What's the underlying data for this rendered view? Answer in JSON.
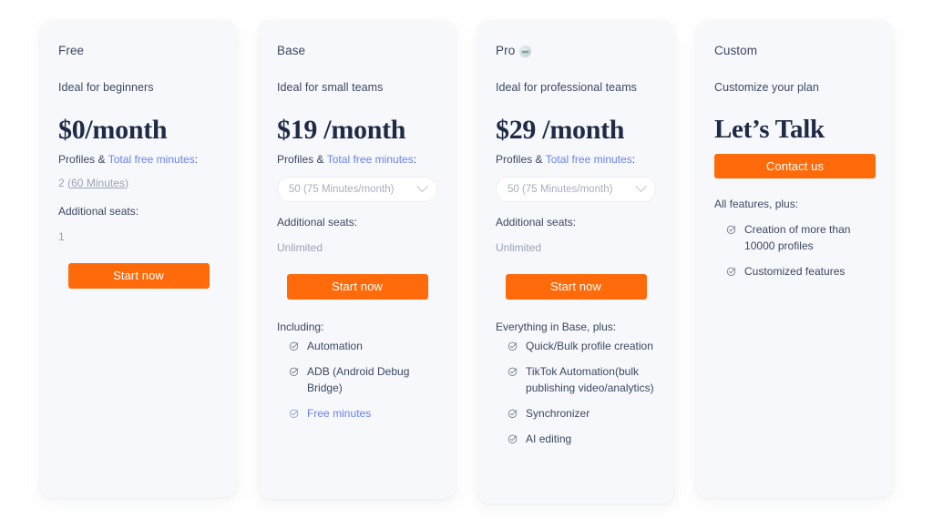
{
  "theme": {
    "accent": "#ff6b0a",
    "card_bg": "#f6f8fb",
    "page_bg": "#ffffff",
    "text": "#3d4761",
    "muted": "#9aa3b4",
    "link": "#6b82ea"
  },
  "plans": [
    {
      "name": "Free",
      "badge_icon": "",
      "tagline": "Ideal for beginners",
      "price": "$0/month",
      "profiles_label_prefix": "Profiles & ",
      "profiles_label_link": "Total free minutes",
      "profiles_label_suffix": ":",
      "profiles_value_plain": "2 ",
      "profiles_value_underlined": "(60 Minutes)",
      "seats_label": "Additional seats:",
      "seats_value": "1",
      "cta_label": "Start now",
      "features_heading": "",
      "features": []
    },
    {
      "name": "Base",
      "badge_icon": "",
      "tagline": "Ideal for small teams",
      "price": "$19 /month",
      "profiles_label_prefix": "Profiles & ",
      "profiles_label_link": "Total free minutes",
      "profiles_label_suffix": ":",
      "select_value": "50 (75 Minutes/month)",
      "select_icon": "chevron-down-icon",
      "seats_label": "Additional seats:",
      "seats_value": "Unlimited",
      "cta_label": "Start now",
      "features_heading": "Including:",
      "features": [
        {
          "text": "Automation",
          "is_link": false,
          "icon": "check-circle-icon"
        },
        {
          "text": "ADB (Android Debug Bridge)",
          "is_link": false,
          "icon": "check-circle-icon"
        },
        {
          "text": "Free minutes",
          "is_link": true,
          "icon": "check-circle-icon"
        }
      ]
    },
    {
      "name": "Pro",
      "badge_icon": "pro-badge-icon",
      "tagline": "Ideal for professional teams",
      "price": "$29 /month",
      "profiles_label_prefix": "Profiles & ",
      "profiles_label_link": "Total free minutes",
      "profiles_label_suffix": ":",
      "select_value": "50 (75 Minutes/month)",
      "select_icon": "chevron-down-icon",
      "seats_label": "Additional seats:",
      "seats_value": "Unlimited",
      "cta_label": "Start now",
      "features_heading": "Everything in Base, plus:",
      "features": [
        {
          "text": "Quick/Bulk profile creation",
          "is_link": false,
          "icon": "check-circle-icon"
        },
        {
          "text": "TikTok Automation(bulk publishing video/analytics)",
          "is_link": false,
          "icon": "check-circle-icon"
        },
        {
          "text": "Synchronizer",
          "is_link": false,
          "icon": "check-circle-icon"
        },
        {
          "text": "AI editing",
          "is_link": false,
          "icon": "check-circle-icon"
        }
      ]
    },
    {
      "name": "Custom",
      "badge_icon": "",
      "tagline": "Customize your plan",
      "price": "Let’s Talk",
      "cta_label": "Contact us",
      "features_heading": "All features, plus:",
      "features": [
        {
          "text": "Creation of more than 10000 profiles",
          "is_link": false,
          "icon": "check-circle-icon"
        },
        {
          "text": "Customized features",
          "is_link": false,
          "icon": "check-circle-icon"
        }
      ]
    }
  ]
}
